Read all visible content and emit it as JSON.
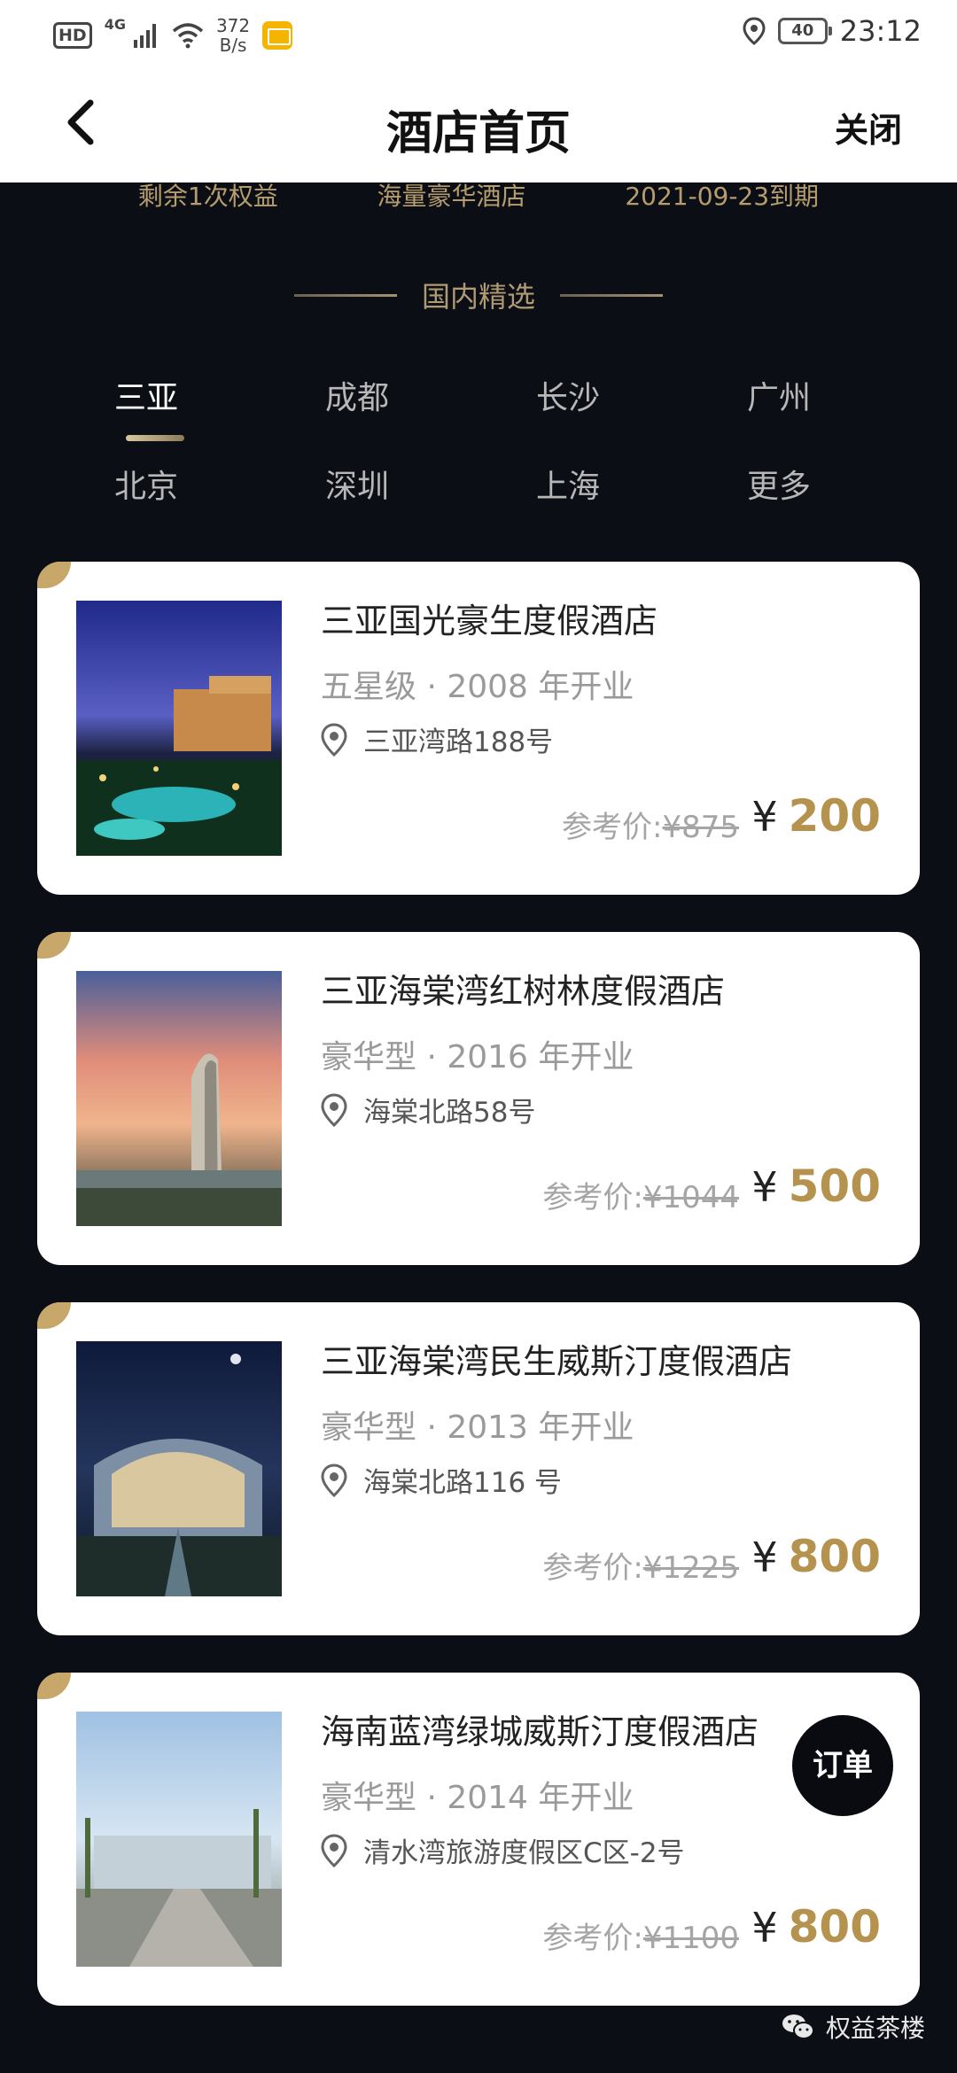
{
  "status_bar": {
    "hd": "HD",
    "network": "4G",
    "speed": "372\nB/s",
    "battery": "40",
    "time": "23:12"
  },
  "nav": {
    "title": "酒店首页",
    "close_label": "关闭"
  },
  "info": {
    "remaining": "剩余1次权益",
    "category": "海量豪华酒店",
    "expiry": "2021-09-23到期"
  },
  "section": {
    "title": "国内精选"
  },
  "cities": {
    "row1": [
      "三亚",
      "成都",
      "长沙",
      "广州"
    ],
    "row2": [
      "北京",
      "深圳",
      "上海",
      "更多"
    ],
    "active": "三亚"
  },
  "hotels": [
    {
      "name": "三亚国光豪生度假酒店",
      "meta": "五星级 · 2008 年开业",
      "address": "三亚湾路188号",
      "ref_label": "参考价:",
      "ref_price": "¥875",
      "currency": "¥",
      "price": "200"
    },
    {
      "name": "三亚海棠湾红树林度假酒店",
      "meta": "豪华型 · 2016 年开业",
      "address": "海棠北路58号",
      "ref_label": "参考价:",
      "ref_price": "¥1044",
      "currency": "¥",
      "price": "500"
    },
    {
      "name": "三亚海棠湾民生威斯汀度假酒店",
      "meta": "豪华型 · 2013 年开业",
      "address": "海棠北路116 号",
      "ref_label": "参考价:",
      "ref_price": "¥1225",
      "currency": "¥",
      "price": "800"
    },
    {
      "name": "海南蓝湾绿城威斯汀度假酒店",
      "meta": "豪华型 · 2014 年开业",
      "address": "清水湾旅游度假区C区-2号",
      "ref_label": "参考价:",
      "ref_price": "¥1100",
      "currency": "¥",
      "price": "800"
    }
  ],
  "order_button": "订单",
  "watermark": "权益茶楼",
  "colors": {
    "gold": "#b5934e",
    "background": "#0c0e15",
    "card": "#ffffff"
  }
}
